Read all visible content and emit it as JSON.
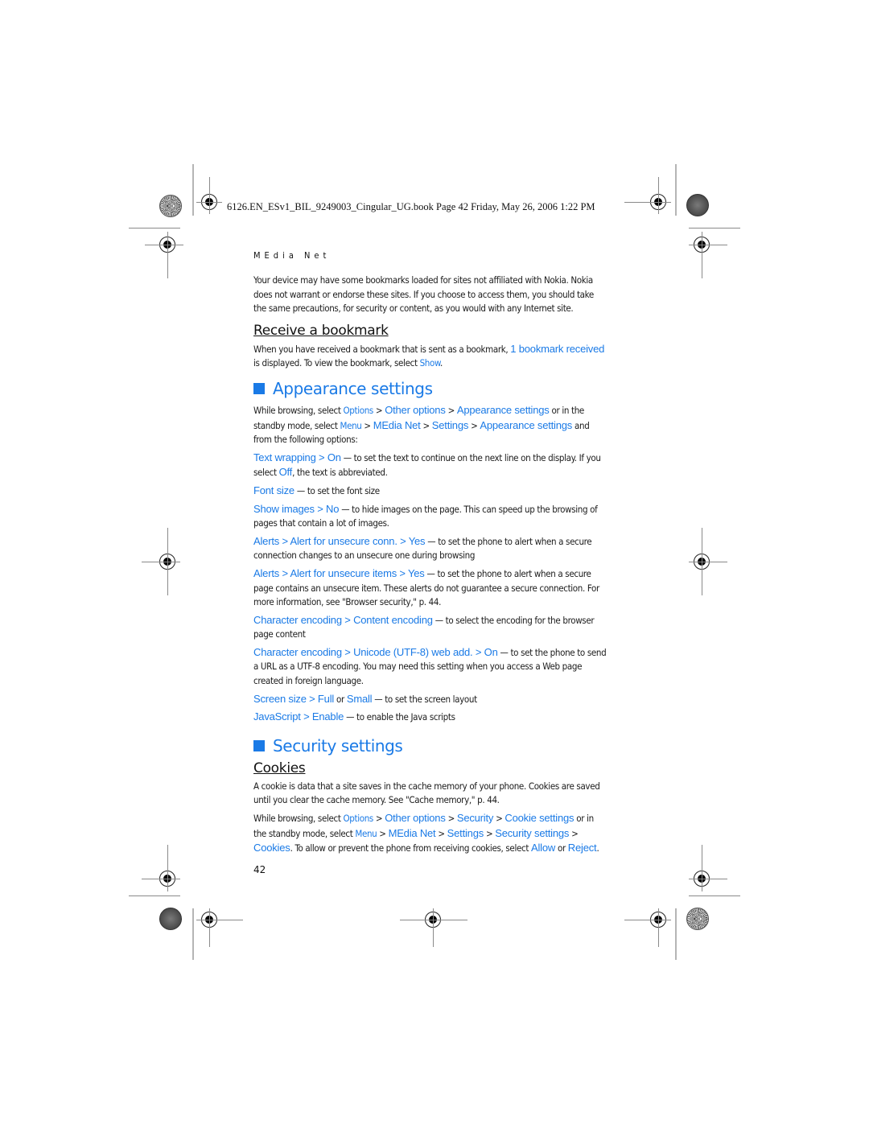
{
  "print_header": "6126.EN_ESv1_BIL_9249003_Cingular_UG.book  Page 42  Friday, May 26, 2006  1:22 PM",
  "running_head": "MEdia Net",
  "intro": "Your device may have some bookmarks loaded for sites not affiliated with Nokia. Nokia does not warrant or endorse these sites. If you choose to access them, you should take the same precautions, for security or content, as you would with any Internet site.",
  "receive_bookmark": {
    "heading": "Receive a bookmark",
    "text_1": "When you have received a bookmark that is sent as a bookmark, ",
    "link_1": "1 bookmark received",
    "text_2": " is displayed. To view the bookmark, select ",
    "link_2": "Show",
    "text_3": "."
  },
  "appearance": {
    "heading": "Appearance settings",
    "intro": {
      "t1": "While browsing, select ",
      "options": "Options",
      "sep1": " > ",
      "other_options": "Other options",
      "sep2": " > ",
      "appearance_settings": "Appearance settings",
      "t2": " or in the standby mode, select ",
      "menu": "Menu",
      "sep3": " > ",
      "media_net": "MEdia Net",
      "sep4": " > ",
      "settings": "Settings",
      "sep5": " > ",
      "appearance_settings_2": "Appearance settings",
      "t3": " and from the following options:"
    },
    "items": [
      {
        "path": "Text wrapping > On",
        "desc": " — to set the text to continue on the next line on the display. If you select ",
        "link": "Off",
        "desc2": ", the text is abbreviated."
      },
      {
        "path": "Font size",
        "desc": " — to set the font size"
      },
      {
        "path": "Show images > No",
        "desc": " — to hide images on the page. This can speed up the browsing of pages that contain a lot of images."
      },
      {
        "path": "Alerts > Alert for unsecure conn. > Yes",
        "desc": " — to set the phone to alert when a secure connection changes to an unsecure one during browsing"
      },
      {
        "path": "Alerts > Alert for unsecure items > Yes",
        "desc": " — to set the phone to alert when a secure page contains an unsecure item. These alerts do not guarantee a secure connection. For more information, see \"Browser security,\" p. 44."
      },
      {
        "path": "Character encoding > Content encoding",
        "desc": " — to select the encoding for the browser page content"
      },
      {
        "path": "Character encoding > Unicode (UTF-8) web add. > On",
        "desc": " — to set the phone to send a URL as a UTF-8 encoding. You may need this setting when you access a Web page created in foreign language."
      },
      {
        "path": "Screen size > Full",
        "mid": " or ",
        "link": "Small",
        "desc": " — to set the screen layout"
      },
      {
        "path": "JavaScript > Enable",
        "desc": " — to enable the Java scripts"
      }
    ]
  },
  "security": {
    "heading": "Security settings",
    "cookies": {
      "heading": "Cookies",
      "text": "A cookie is data that a site saves in the cache memory of your phone. Cookies are saved until you clear the cache memory. See \"Cache memory,\" p. 44.",
      "nav": {
        "t1": "While browsing, select ",
        "options": "Options",
        "sep1": " > ",
        "other_options": "Other options",
        "sep2": " > ",
        "security": "Security",
        "sep3": " > ",
        "cookie_settings": "Cookie settings",
        "t2": " or in the standby mode, select ",
        "menu": "Menu",
        "sep4": " > ",
        "media_net": "MEdia Net",
        "sep5": " > ",
        "settings": "Settings",
        "sep6": " > ",
        "security_settings": "Security settings",
        "sep7": " > ",
        "cookies": "Cookies",
        "t3": ". To allow or prevent the phone from receiving cookies, select ",
        "allow": "Allow",
        "t4": " or ",
        "reject": "Reject",
        "t5": "."
      }
    }
  },
  "page_number": "42",
  "colors": {
    "accent": "#1a7ae6",
    "text": "#1a1a1a"
  }
}
